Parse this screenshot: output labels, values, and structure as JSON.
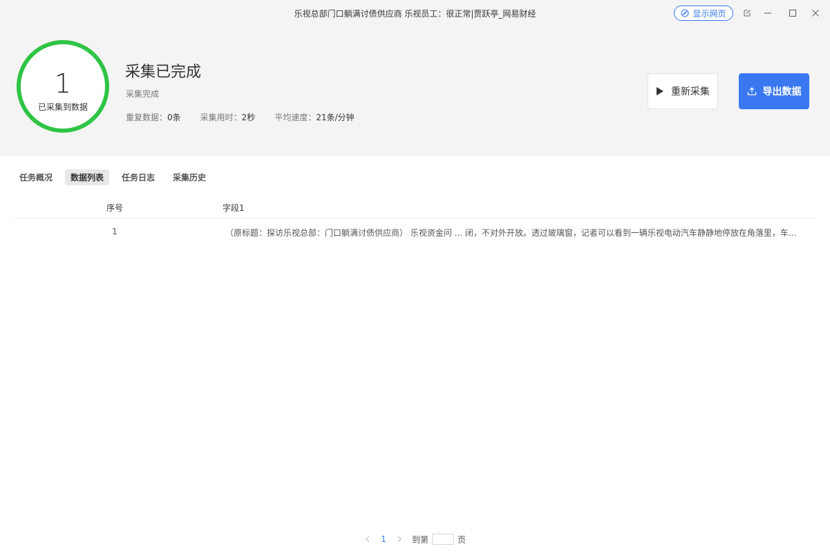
{
  "window": {
    "title": "乐视总部门口躺满讨债供应商 乐视员工：很正常|贾跃亭_网易财经",
    "show_web_label": "显示网页",
    "controls": [
      "edit-icon",
      "minimize-icon",
      "maximize-icon",
      "close-icon"
    ]
  },
  "summary": {
    "count": "1",
    "count_label": "已采集到数据",
    "status_title": "采集已完成",
    "status_sub": "采集完成",
    "stats": {
      "dup_label": "重复数据：",
      "dup_value": "0条",
      "time_label": "采集用时：",
      "time_value": "2秒",
      "speed_label": "平均速度：",
      "speed_value": "21条/分钟"
    },
    "ring_color": "#2fc445"
  },
  "actions": {
    "recollect_label": "重新采集",
    "export_label": "导出数据",
    "accent": "#3a78f2"
  },
  "tabs": [
    {
      "label": "任务概况",
      "active": false
    },
    {
      "label": "数据列表",
      "active": true
    },
    {
      "label": "任务日志",
      "active": false
    },
    {
      "label": "采集历史",
      "active": false
    }
  ],
  "table": {
    "columns": [
      "序号",
      "字段1"
    ],
    "rows": [
      [
        "1",
        "（原标题：探访乐视总部：门口躺满讨债供应商） 乐视资金问 ... 闭，不对外开放。透过玻璃窗，记者可以看到一辆乐视电动汽车静静地停放在角落里，车身上落满了灰尘，显得很冷清。"
      ]
    ]
  },
  "pagination": {
    "current_page": "1",
    "goto_label": "到第",
    "page_suffix": "页",
    "goto_value": ""
  }
}
